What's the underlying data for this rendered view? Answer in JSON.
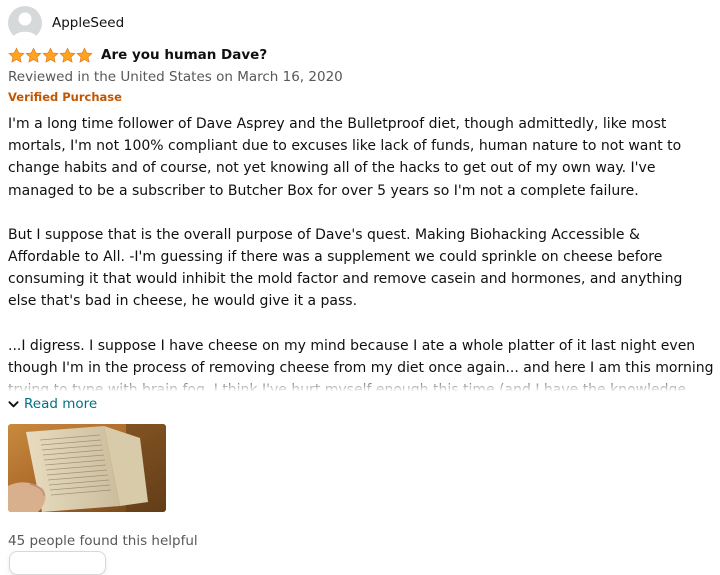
{
  "review": {
    "profile_name": "AppleSeed",
    "rating": 5,
    "title": "Are you human Dave?",
    "date": "Reviewed in the United States on March 16, 2020",
    "verified": "Verified Purchase",
    "paragraphs": [
      "I'm a long time follower of Dave Asprey and the Bulletproof diet, though admittedly, like most mortals, I'm not 100% compliant due to excuses like lack of funds, human nature to not want to change habits and of course, not yet knowing all of the hacks to get out of my own way. I've managed to be a subscriber to Butcher Box for over 5 years so I'm not a complete failure.",
      "But I suppose that is the overall purpose of Dave's quest. Making Biohacking Accessible & Affordable to All. -I'm guessing if there was a supplement we could sprinkle on cheese before consuming it that would inhibit the mold factor and remove casein and hormones, and anything else that's bad in cheese, he would give it a pass.",
      "...I digress. I suppose I have cheese on my mind because I ate a whole platter of it last night even though I'm in the process of removing cheese from my diet once again... and here I am this morning trying to type with brain fog. I think I've hurt myself enough this time (and I have the knowledge from this book) to actually follow-through the next time I'm tempted to give in to my lazy human nature."
    ],
    "read_more": "Read more",
    "helpful": "45 people found this helpful"
  },
  "colors": {
    "star": "#ffa41c",
    "verified": "#c45500",
    "link": "#007185",
    "secondary_text": "#565959"
  },
  "icons": {
    "avatar": "user-avatar-icon",
    "star": "star-icon",
    "read_more": "chevron-down-icon"
  }
}
